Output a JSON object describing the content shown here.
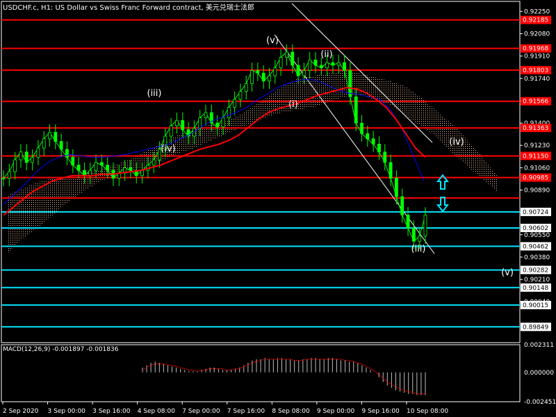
{
  "header": {
    "title": "USDCHF.c, H1:  US Dollar vs Swiss Franc Forward contract, 美元兑瑞士法郎"
  },
  "macd_header": {
    "label": "MACD(12,26,9) -0.001897 -0.001836"
  },
  "colors": {
    "background": "#000000",
    "frame": "#ffffff",
    "candle": "#00ff00",
    "red_level": "#ff0000",
    "cyan_level": "#00e5ff",
    "ma_red": "#ff0000",
    "ma_blue": "#0000ff",
    "cloud": "#f4c2a0",
    "macd_hist": "#c0c0c0",
    "macd_signal": "#ff0000"
  },
  "chart_data": {
    "type": "line",
    "symbol": "USDCHF.c",
    "timeframe": "H1",
    "x_tick_labels": [
      "2 Sep 2020",
      "3 Sep 00:00",
      "3 Sep 16:00",
      "4 Sep 08:00",
      "7 Sep 00:00",
      "7 Sep 16:00",
      "8 Sep 08:00",
      "9 Sep 00:00",
      "9 Sep 16:00",
      "10 Sep 08:00"
    ],
    "price_axis": {
      "ylim": [
        0.89729,
        0.92326
      ],
      "tick_labels": [
        "0.92250",
        "0.92080",
        "0.91910",
        "0.91740",
        "0.91570",
        "0.91400",
        "0.91230",
        "0.91060",
        "0.90890",
        "0.90720",
        "0.90550",
        "0.90380",
        "0.90210",
        "0.90040"
      ]
    },
    "red_levels": [
      {
        "label": "0.92185",
        "value": 0.92185
      },
      {
        "label": "0.91968",
        "value": 0.91968
      },
      {
        "label": "0.91803",
        "value": 0.91803
      },
      {
        "label": "0.91566",
        "value": 0.91566
      },
      {
        "label": "0.91363",
        "value": 0.91363
      },
      {
        "label": "0.91150",
        "value": 0.9115
      },
      {
        "label": "0.90985",
        "value": 0.90985
      },
      {
        "label": "",
        "value": 0.9083
      }
    ],
    "cyan_levels": [
      {
        "label": "0.90724",
        "value": 0.90724
      },
      {
        "label": "0.90602",
        "value": 0.90602
      },
      {
        "label": "0.90462",
        "value": 0.90462
      },
      {
        "label": "0.90282",
        "value": 0.90282
      },
      {
        "label": "0.90148",
        "value": 0.90148
      },
      {
        "label": "0.90015",
        "value": 0.90015
      },
      {
        "label": "0.89849",
        "value": 0.89849
      }
    ],
    "price_close": [
      0.9098,
      0.9103,
      0.9112,
      0.9118,
      0.911,
      0.9114,
      0.9121,
      0.9128,
      0.9133,
      0.9126,
      0.912,
      0.9114,
      0.9108,
      0.9104,
      0.91,
      0.9104,
      0.911,
      0.9108,
      0.9104,
      0.9098,
      0.9102,
      0.9106,
      0.9104,
      0.91,
      0.9104,
      0.9108,
      0.9112,
      0.912,
      0.913,
      0.9138,
      0.9142,
      0.9135,
      0.913,
      0.9136,
      0.9144,
      0.9148,
      0.914,
      0.9137,
      0.9144,
      0.9152,
      0.9158,
      0.9164,
      0.917,
      0.918,
      0.9178,
      0.9172,
      0.9176,
      0.9182,
      0.919,
      0.9194,
      0.9184,
      0.9176,
      0.918,
      0.9188,
      0.9184,
      0.9182,
      0.9186,
      0.9184,
      0.9186,
      0.918,
      0.916,
      0.914,
      0.9132,
      0.9128,
      0.9124,
      0.9118,
      0.911,
      0.9098,
      0.9084,
      0.907,
      0.906,
      0.905,
      0.9054,
      0.907
    ],
    "ma_red": [
      0.907,
      0.9076,
      0.9082,
      0.9088,
      0.9092,
      0.9096,
      0.9098,
      0.91,
      0.91,
      0.91,
      0.9101,
      0.9101,
      0.9102,
      0.9103,
      0.9104,
      0.9106,
      0.9108,
      0.9111,
      0.9114,
      0.9117,
      0.912,
      0.9122,
      0.9124,
      0.9127,
      0.9131,
      0.9137,
      0.9143,
      0.9148,
      0.9151,
      0.9153,
      0.9155,
      0.9158,
      0.9161,
      0.9163,
      0.9165,
      0.9167,
      0.9166,
      0.9163,
      0.9158,
      0.9152,
      0.9143,
      0.9132,
      0.9121,
      0.9114
    ],
    "ma_blue": [
      0.9078,
      0.9086,
      0.9094,
      0.9103,
      0.911,
      0.9114,
      0.9116,
      0.9115,
      0.9114,
      0.9114,
      0.9115,
      0.9116,
      0.9118,
      0.912,
      0.9122,
      0.9124,
      0.9128,
      0.9132,
      0.9138,
      0.9142,
      0.9145,
      0.9148,
      0.9152,
      0.9158,
      0.9163,
      0.9168,
      0.9171,
      0.9173,
      0.9173,
      0.917,
      0.9166,
      0.9163,
      0.9162,
      0.916,
      0.9158,
      0.915,
      0.9136,
      0.9116,
      0.9096
    ],
    "cloud_upper": [
      0.9085,
      0.909,
      0.9095,
      0.9098,
      0.91,
      0.9102,
      0.9104,
      0.9108,
      0.9112,
      0.9118,
      0.9124,
      0.913,
      0.9134,
      0.9138,
      0.914,
      0.9145,
      0.9152,
      0.916,
      0.9168,
      0.9174,
      0.9176,
      0.9178,
      0.918,
      0.9178,
      0.9175,
      0.9172,
      0.9168,
      0.916,
      0.915,
      0.914,
      0.9128,
      0.9115,
      0.91
    ],
    "cloud_lower": [
      0.904,
      0.9052,
      0.906,
      0.907,
      0.908,
      0.9088,
      0.9095,
      0.91,
      0.9104,
      0.9106,
      0.911,
      0.9116,
      0.912,
      0.9125,
      0.913,
      0.9135,
      0.914,
      0.9145,
      0.9148,
      0.915,
      0.9152,
      0.9156,
      0.916,
      0.9162,
      0.9158,
      0.9154,
      0.9146,
      0.9138,
      0.913,
      0.9118,
      0.9108,
      0.9098,
      0.9088
    ],
    "wave_labels": [
      "(iii)",
      "(iv)",
      "(v)",
      "(i)",
      "(ii)",
      "(iii)",
      "(iv)",
      "(v)"
    ],
    "macd": {
      "label": "MACD(12,26,9)",
      "main": -0.001897,
      "signal": -0.001836,
      "ylim": [
        -0.002451,
        0.002311
      ],
      "tick_labels": [
        "0.002311",
        "0.000000",
        "-0.002451"
      ],
      "histogram": [
        0.0004,
        0.0006,
        0.0008,
        0.0009,
        0.0008,
        0.0007,
        0.0006,
        0.0005,
        0.0004,
        0.0003,
        0.0002,
        0.0001,
        0.0001,
        0.0001,
        0.0002,
        0.0003,
        0.0004,
        0.0004,
        0.0003,
        0.0002,
        0.0002,
        0.0002,
        0.0003,
        0.0004,
        0.0006,
        0.0008,
        0.001,
        0.0011,
        0.0011,
        0.0012,
        0.0011,
        0.0011,
        0.0012,
        0.0012,
        0.0011,
        0.0011,
        0.001,
        0.001,
        0.0011,
        0.0011,
        0.0012,
        0.0012,
        0.0011,
        0.0011,
        0.0012,
        0.0012,
        0.0011,
        0.001,
        0.001,
        0.0009,
        0.0009,
        0.0008,
        0.0006,
        0.0004,
        0.0002,
        0.0,
        -0.0004,
        -0.0008,
        -0.0011,
        -0.0013,
        -0.0015,
        -0.0016,
        -0.0017,
        -0.0018,
        -0.0018,
        -0.0019,
        -0.0019,
        -0.0019
      ],
      "signal_line": [
        0.0002,
        0.0004,
        0.0006,
        0.0007,
        0.0007,
        0.0007,
        0.0006,
        0.0006,
        0.0005,
        0.0004,
        0.0003,
        0.0002,
        0.0002,
        0.0001,
        0.0002,
        0.0002,
        0.0003,
        0.0003,
        0.0003,
        0.0003,
        0.0002,
        0.0002,
        0.0003,
        0.0003,
        0.0005,
        0.0006,
        0.0008,
        0.0009,
        0.001,
        0.0011,
        0.0011,
        0.0011,
        0.0011,
        0.0011,
        0.0011,
        0.0011,
        0.001,
        0.001,
        0.001,
        0.0011,
        0.0011,
        0.0011,
        0.0011,
        0.0011,
        0.0011,
        0.0011,
        0.0011,
        0.0011,
        0.001,
        0.001,
        0.0009,
        0.0008,
        0.0007,
        0.0005,
        0.0003,
        0.0001,
        -0.0002,
        -0.0005,
        -0.0008,
        -0.001,
        -0.0012,
        -0.0014,
        -0.0015,
        -0.0016,
        -0.0017,
        -0.0018,
        -0.0018,
        -0.0018
      ]
    }
  }
}
